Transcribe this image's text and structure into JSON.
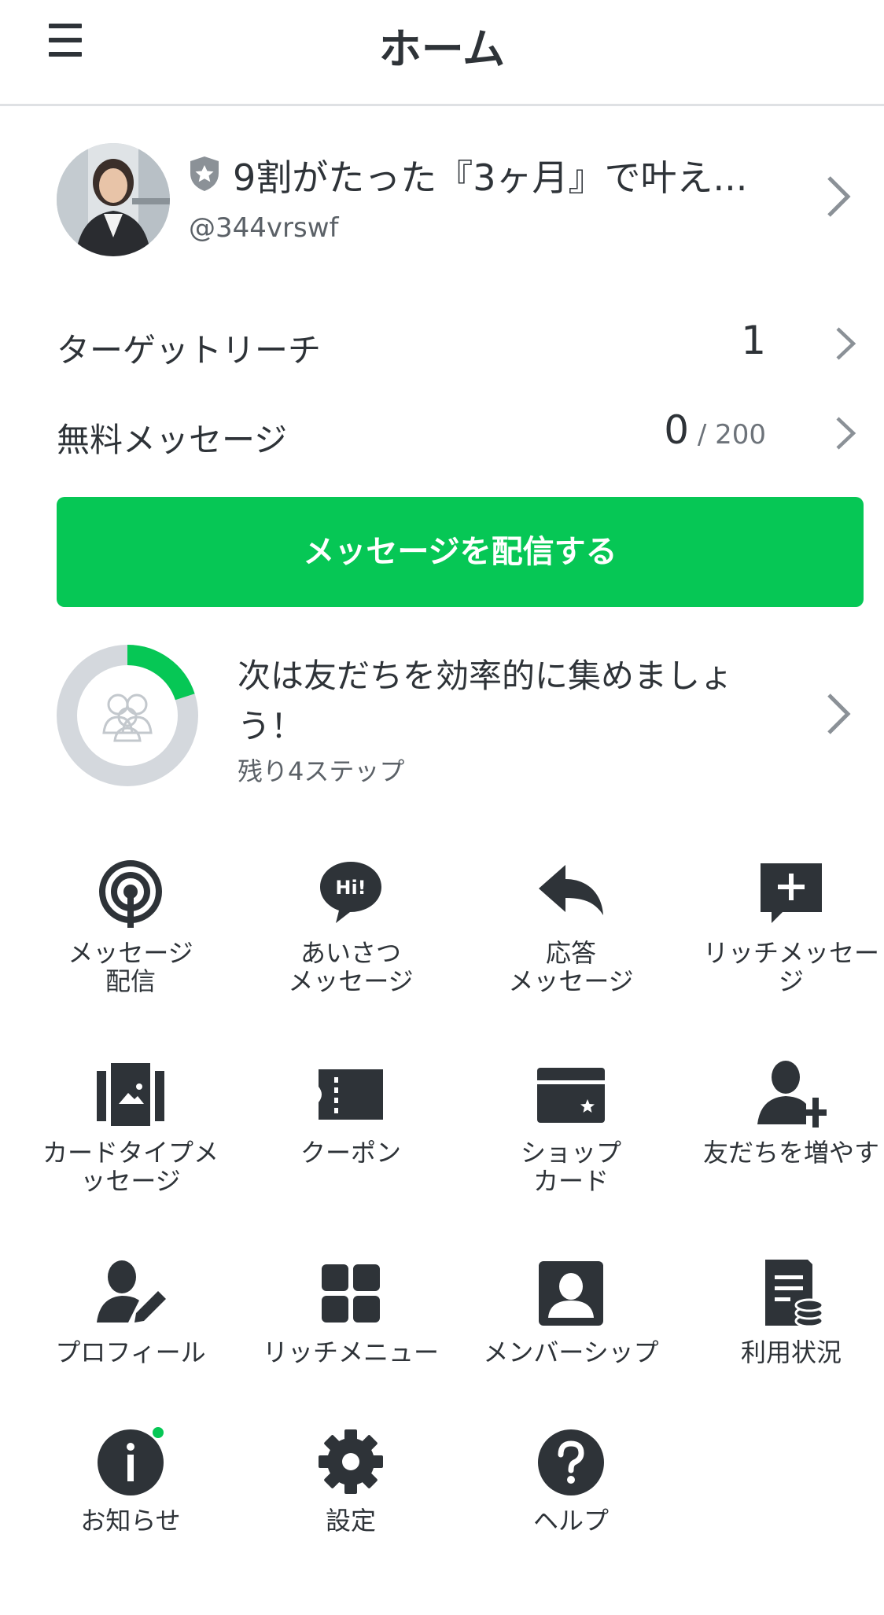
{
  "header": {
    "title": "ホーム"
  },
  "account": {
    "name": "9割がたった『3ヶ月』で叶え...",
    "id": "@344vrswf"
  },
  "stats": [
    {
      "label": "ターゲットリーチ",
      "value": "1",
      "max": ""
    },
    {
      "label": "無料メッセージ",
      "value": "0",
      "max": " / 200"
    }
  ],
  "cta": {
    "label": "メッセージを配信する"
  },
  "progress": {
    "title": "次は友だちを効率的に集めましょう！",
    "subtitle": "残り4ステップ",
    "fraction": 0.2
  },
  "menu": [
    {
      "label": "メッセージ\n配信",
      "icon": "broadcast-icon"
    },
    {
      "label": "あいさつ\nメッセージ",
      "icon": "greeting-icon"
    },
    {
      "label": "応答\nメッセージ",
      "icon": "reply-icon"
    },
    {
      "label": "リッチメッセー\nジ",
      "icon": "rich-message-icon"
    },
    {
      "label": "カードタイプメ\nッセージ",
      "icon": "card-type-icon"
    },
    {
      "label": "クーポン",
      "icon": "coupon-icon"
    },
    {
      "label": "ショップ\nカード",
      "icon": "shop-card-icon"
    },
    {
      "label": "友だちを増やす",
      "icon": "add-friend-icon"
    },
    {
      "label": "プロフィール",
      "icon": "profile-icon"
    },
    {
      "label": "リッチメニュー",
      "icon": "rich-menu-icon"
    },
    {
      "label": "メンバーシップ",
      "icon": "membership-icon"
    },
    {
      "label": "利用状況",
      "icon": "usage-icon"
    },
    {
      "label": "お知らせ",
      "icon": "info-icon"
    },
    {
      "label": "設定",
      "icon": "settings-icon"
    },
    {
      "label": "ヘルプ",
      "icon": "help-icon"
    }
  ],
  "colors": {
    "brand_green": "#06c755",
    "text": "#2e3338",
    "ring_track": "#d4d8dd"
  }
}
